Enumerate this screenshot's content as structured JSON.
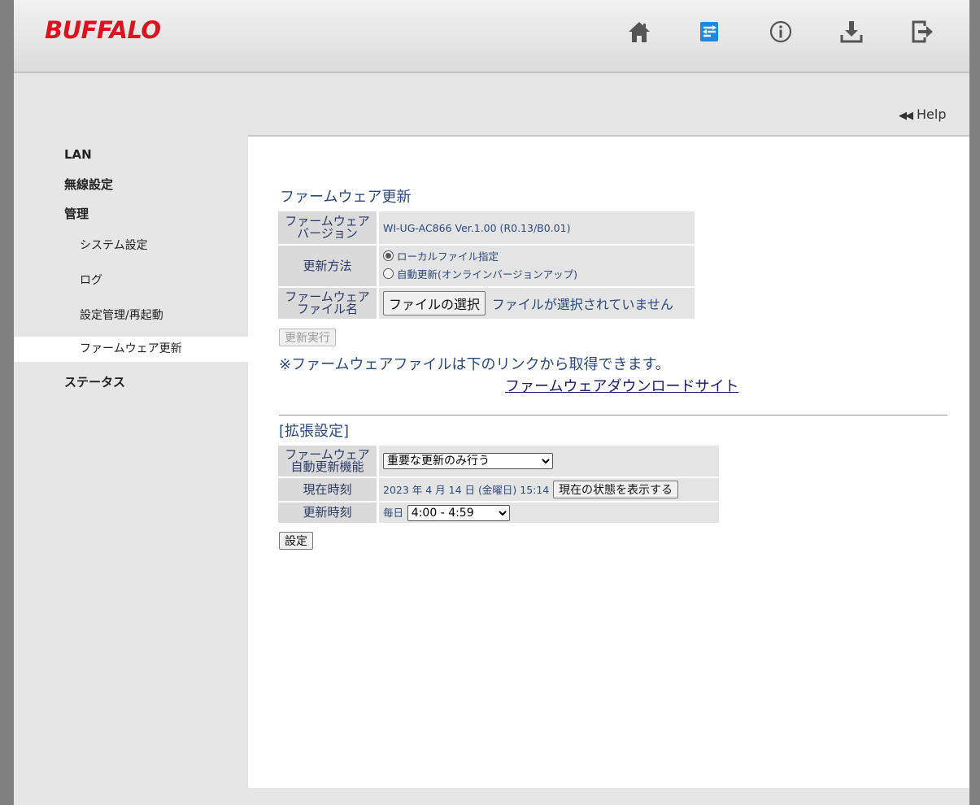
{
  "brand": {
    "logo": "BUFFALO"
  },
  "topnav": [
    {
      "name": "home-icon"
    },
    {
      "name": "settings-icon"
    },
    {
      "name": "info-icon"
    },
    {
      "name": "download-icon"
    },
    {
      "name": "logout-icon"
    }
  ],
  "help": {
    "arrows": "◀◀",
    "label": "Help"
  },
  "sidebar": {
    "items": [
      {
        "label": "LAN"
      },
      {
        "label": "無線設定"
      },
      {
        "label": "管理"
      },
      {
        "label": "システム設定"
      },
      {
        "label": "ログ"
      },
      {
        "label": "設定管理/再起動"
      },
      {
        "label": "ファームウェア更新"
      },
      {
        "label": "ステータス"
      }
    ]
  },
  "firmware": {
    "title": "ファームウェア更新",
    "version_label_1": "ファームウェア",
    "version_label_2": "バージョン",
    "version_value": "WI-UG-AC866 Ver.1.00 (R0.13/B0.01)",
    "method_label": "更新方法",
    "method_option_local": "ローカルファイル指定",
    "method_option_auto": "自動更新(オンラインバージョンアップ)",
    "file_label_1": "ファームウェア",
    "file_label_2": "ファイル名",
    "file_button": "ファイルの選択",
    "file_status": "ファイルが選択されていません",
    "execute_button": "更新実行",
    "note": "※ファームウェアファイルは下のリンクから取得できます。",
    "download_link": "ファームウェアダウンロードサイト"
  },
  "advanced": {
    "title": "[拡張設定]",
    "auto_label_1": "ファームウェア",
    "auto_label_2": "自動更新機能",
    "auto_select": "重要な更新のみ行う",
    "time_label": "現在時刻",
    "time_value": "2023 年 4 月 14 日 (金曜日) 15:14",
    "time_button": "現在の状態を表示する",
    "update_time_label": "更新時刻",
    "update_time_prefix": "毎日",
    "update_time_select": "4:00 - 4:59",
    "submit_button": "設定"
  },
  "colors": {
    "accent": "#e0101e",
    "active_icon": "#1e88e5",
    "label_text": "#2b4a7a"
  }
}
